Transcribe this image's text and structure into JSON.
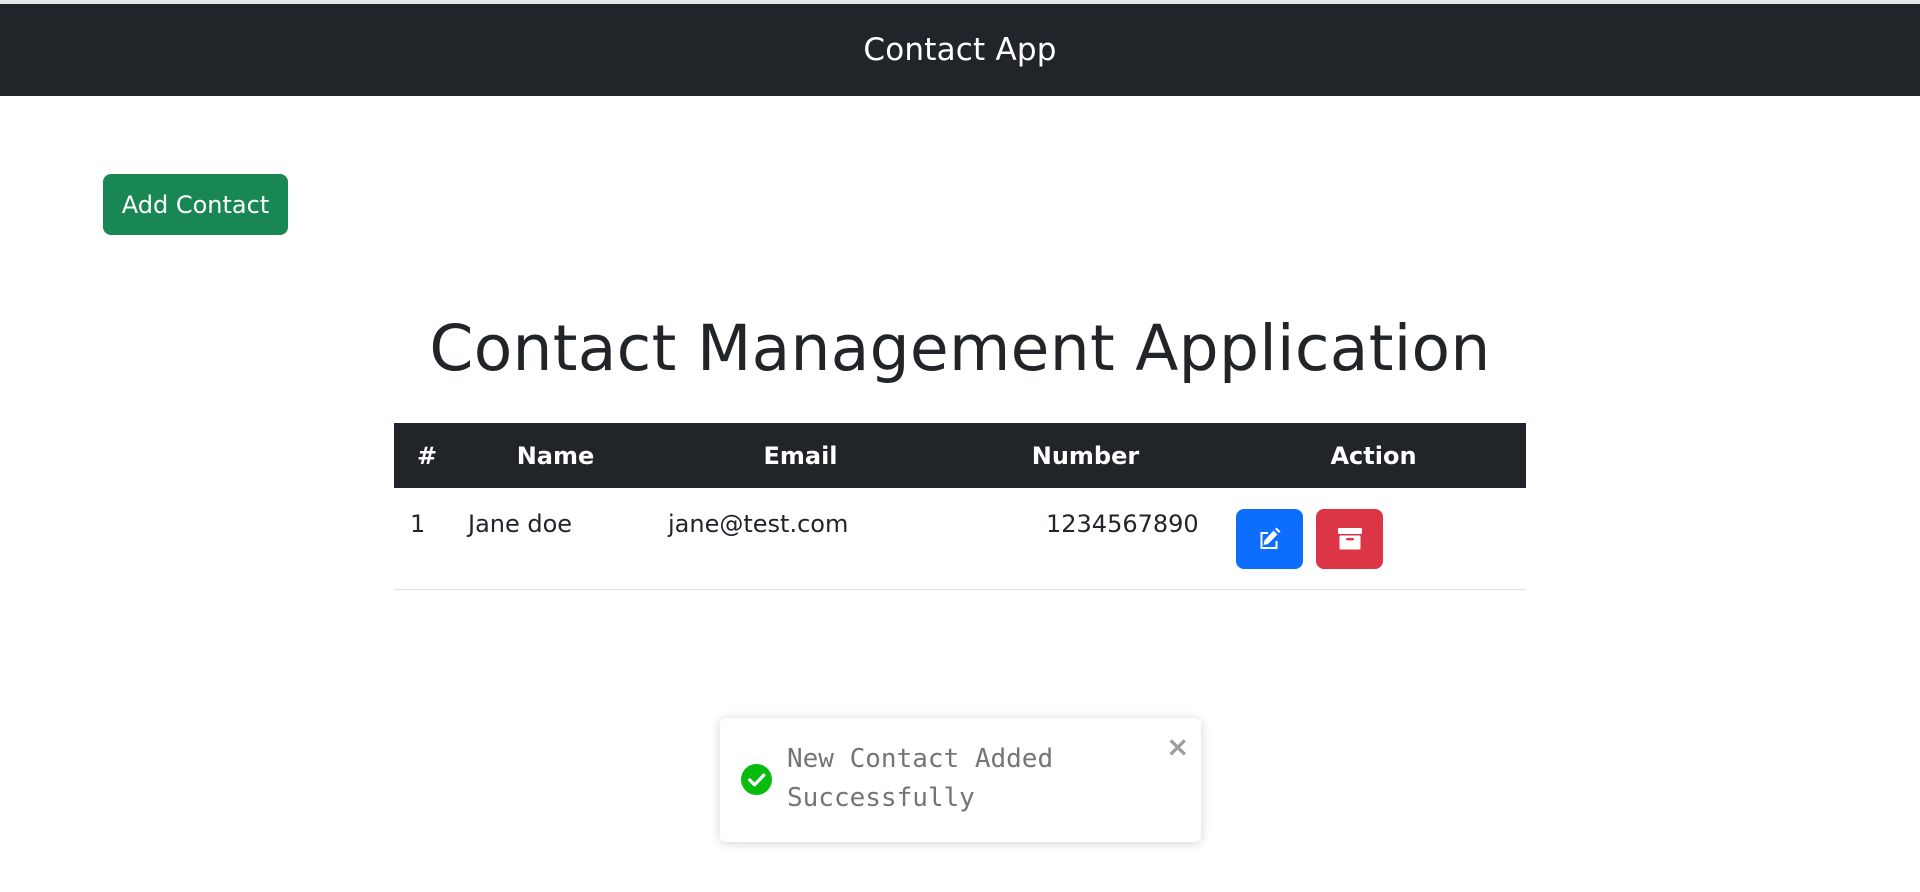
{
  "navbar": {
    "title": "Contact App"
  },
  "add_contact_button": {
    "label": "Add Contact",
    "color": "#198754"
  },
  "page_title": "Contact Management Application",
  "table": {
    "headers": [
      "#",
      "Name",
      "Email",
      "Number",
      "Action"
    ],
    "rows": [
      {
        "index": "1",
        "name": "Jane doe",
        "email": "jane@test.com",
        "number": "1234567890"
      }
    ]
  },
  "actions": {
    "edit_icon": "edit-icon",
    "delete_icon": "archive-icon",
    "edit_color": "#0d6efd",
    "delete_color": "#dc3545"
  },
  "toast": {
    "message": "New Contact Added Successfully",
    "status": "success",
    "status_color": "#07bc0c",
    "close_glyph": "×"
  }
}
